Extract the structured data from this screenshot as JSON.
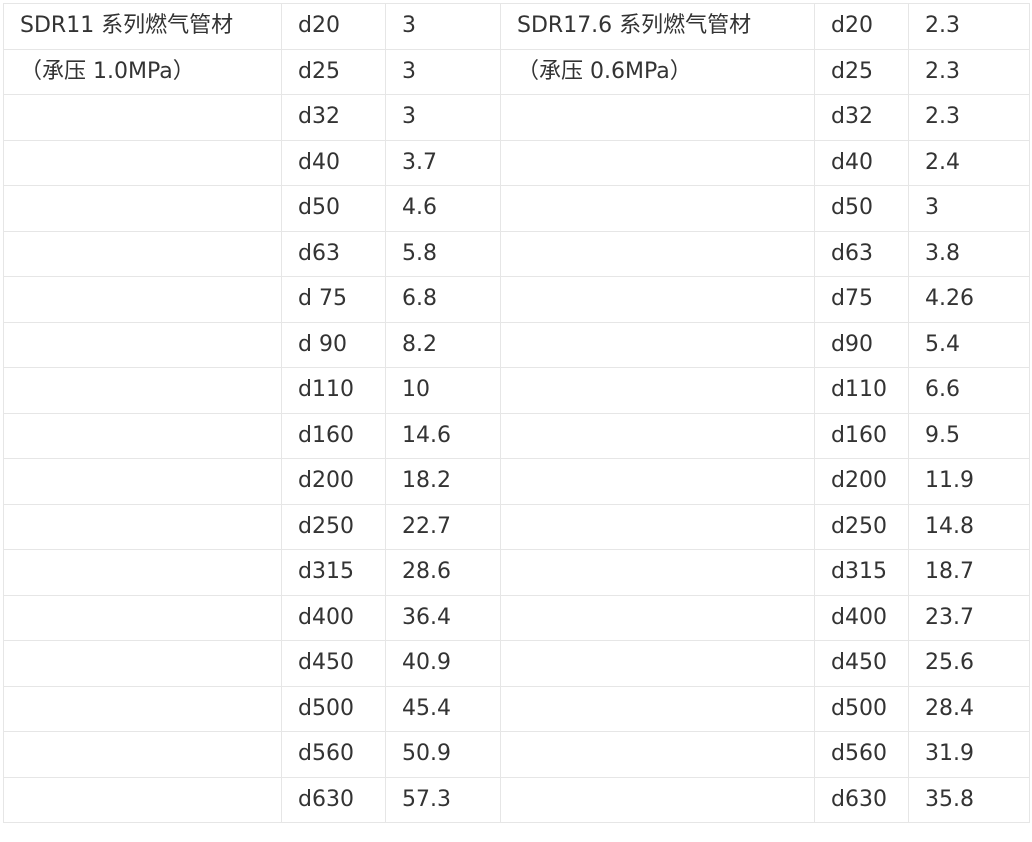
{
  "series": [
    {
      "name": "SDR11 系列燃气管材",
      "pressure": "（承压 1.0MPa）",
      "rows": [
        {
          "d": "d20",
          "t": "3"
        },
        {
          "d": "d25",
          "t": "3"
        },
        {
          "d": "d32",
          "t": "3"
        },
        {
          "d": "d40",
          "t": "3.7"
        },
        {
          "d": "d50",
          "t": "4.6"
        },
        {
          "d": "d63",
          "t": "5.8"
        },
        {
          "d": "d 75",
          "t": "6.8"
        },
        {
          "d": "d 90",
          "t": "8.2"
        },
        {
          "d": "d110",
          "t": "10"
        },
        {
          "d": "d160",
          "t": "14.6"
        },
        {
          "d": "d200",
          "t": "18.2"
        },
        {
          "d": "d250",
          "t": "22.7"
        },
        {
          "d": "d315",
          "t": "28.6"
        },
        {
          "d": "d400",
          "t": "36.4"
        },
        {
          "d": "d450",
          "t": "40.9"
        },
        {
          "d": "d500",
          "t": "45.4"
        },
        {
          "d": "d560",
          "t": "50.9"
        },
        {
          "d": "d630",
          "t": "57.3"
        }
      ]
    },
    {
      "name": "SDR17.6 系列燃气管材",
      "pressure": "（承压 0.6MPa）",
      "rows": [
        {
          "d": "d20",
          "t": "2.3"
        },
        {
          "d": "d25",
          "t": "2.3"
        },
        {
          "d": "d32",
          "t": "2.3"
        },
        {
          "d": "d40",
          "t": "2.4"
        },
        {
          "d": "d50",
          "t": "3"
        },
        {
          "d": "d63",
          "t": "3.8"
        },
        {
          "d": "d75",
          "t": "4.26"
        },
        {
          "d": "d90",
          "t": "5.4"
        },
        {
          "d": "d110",
          "t": "6.6"
        },
        {
          "d": "d160",
          "t": "9.5"
        },
        {
          "d": "d200",
          "t": "11.9"
        },
        {
          "d": "d250",
          "t": "14.8"
        },
        {
          "d": "d315",
          "t": "18.7"
        },
        {
          "d": "d400",
          "t": "23.7"
        },
        {
          "d": "d450",
          "t": "25.6"
        },
        {
          "d": "d500",
          "t": "28.4"
        },
        {
          "d": "d560",
          "t": "31.9"
        },
        {
          "d": "d630",
          "t": "35.8"
        }
      ]
    }
  ]
}
